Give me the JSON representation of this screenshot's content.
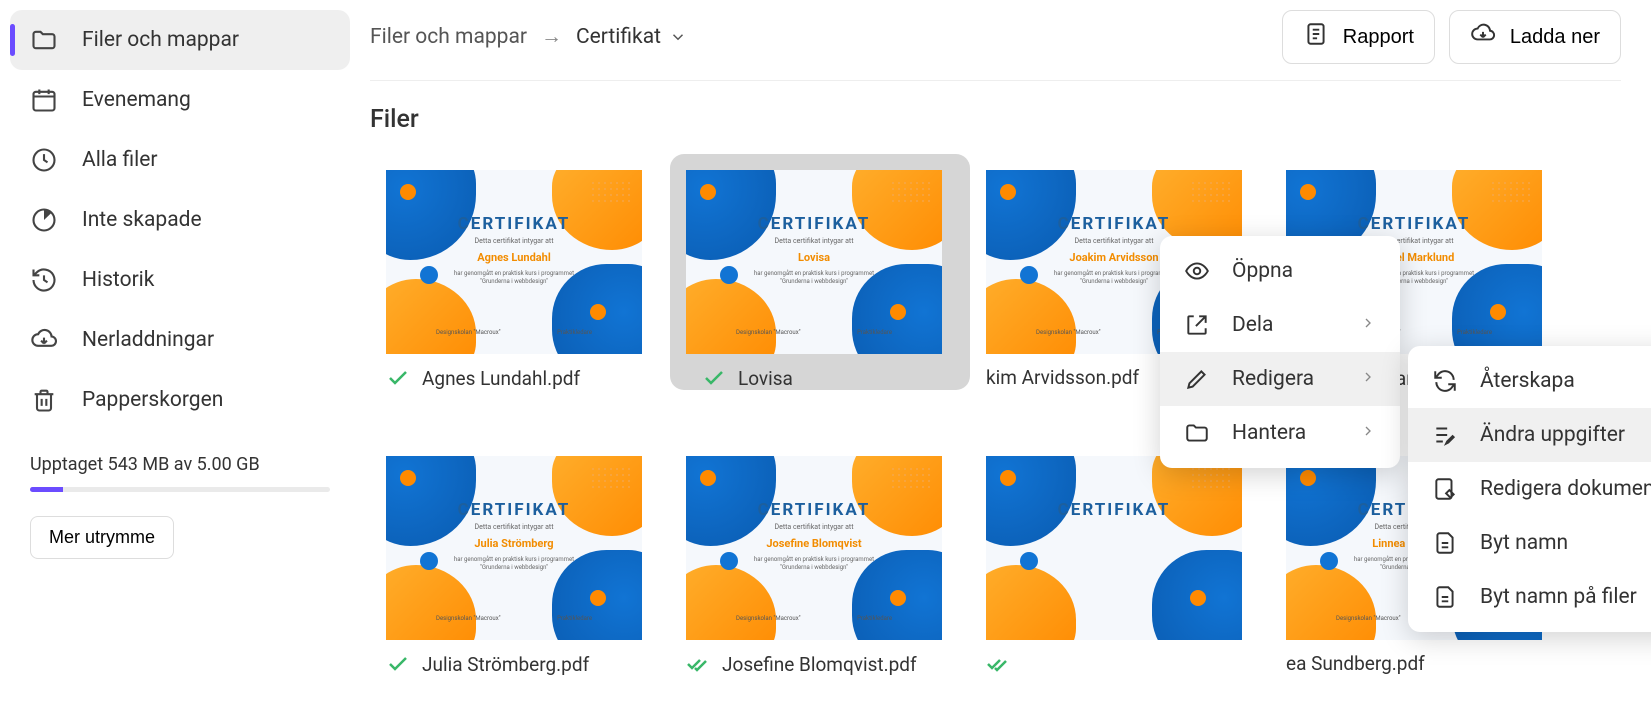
{
  "sidebar": {
    "items": [
      {
        "label": "Filer och mappar",
        "icon": "folder",
        "active": true
      },
      {
        "label": "Evenemang",
        "icon": "calendar"
      },
      {
        "label": "Alla filer",
        "icon": "clock"
      },
      {
        "label": "Inte skapade",
        "icon": "pie"
      },
      {
        "label": "Historik",
        "icon": "history"
      },
      {
        "label": "Nerladdningar",
        "icon": "download"
      },
      {
        "label": "Papperskorgen",
        "icon": "trash"
      }
    ],
    "storage_text": "Upptaget 543 MB av 5.00 GB",
    "storage_percent": 11,
    "more_storage": "Mer utrymme"
  },
  "breadcrumb": {
    "root": "Filer och mappar",
    "current": "Certifikat"
  },
  "top_actions": {
    "report": "Rapport",
    "download": "Ladda ner"
  },
  "section_title": "Filer",
  "cert_common": {
    "title": "CERTIFIKAT",
    "subtitle": "Detta certifikat intygar att",
    "desc1": "har genomgått en praktisk kurs i programmet",
    "desc2": "\"Grunderna i webbdesign\"",
    "footer_left": "Designskolan \"Macroux\"",
    "footer_right": "Praktikledare"
  },
  "files": [
    {
      "name": "Agnes Lundahl",
      "filename": "Agnes Lundahl.pdf",
      "status": "check"
    },
    {
      "name": "Lovisa",
      "filename": "Lovisa",
      "status": "check",
      "selected": true
    },
    {
      "name": "Joakim Arvidsson",
      "filename": "kim Arvidsson.pdf",
      "status": "none"
    },
    {
      "name": "Daniel Marklund",
      "filename": "Daniel Marklund.pdf",
      "status": "x"
    },
    {
      "name": "Julia Strömberg",
      "filename": "Julia Strömberg.pdf",
      "status": "check"
    },
    {
      "name": "Josefine Blomqvist",
      "filename": "Josefine Blomqvist.pdf",
      "status": "dblcheck"
    },
    {
      "name": "",
      "filename": "",
      "status": "dblcheck"
    },
    {
      "name": "Linnea Sundberg",
      "filename": "ea Sundberg.pdf",
      "status": "none"
    }
  ],
  "context_menu": {
    "open": "Öppna",
    "share": "Dela",
    "edit": "Redigera",
    "manage": "Hantera"
  },
  "edit_submenu": {
    "recreate": "Återskapa",
    "change_data": "Ändra uppgifter",
    "edit_document": "Redigera dokument",
    "rename": "Byt namn",
    "rename_files": "Byt namn på filer"
  }
}
